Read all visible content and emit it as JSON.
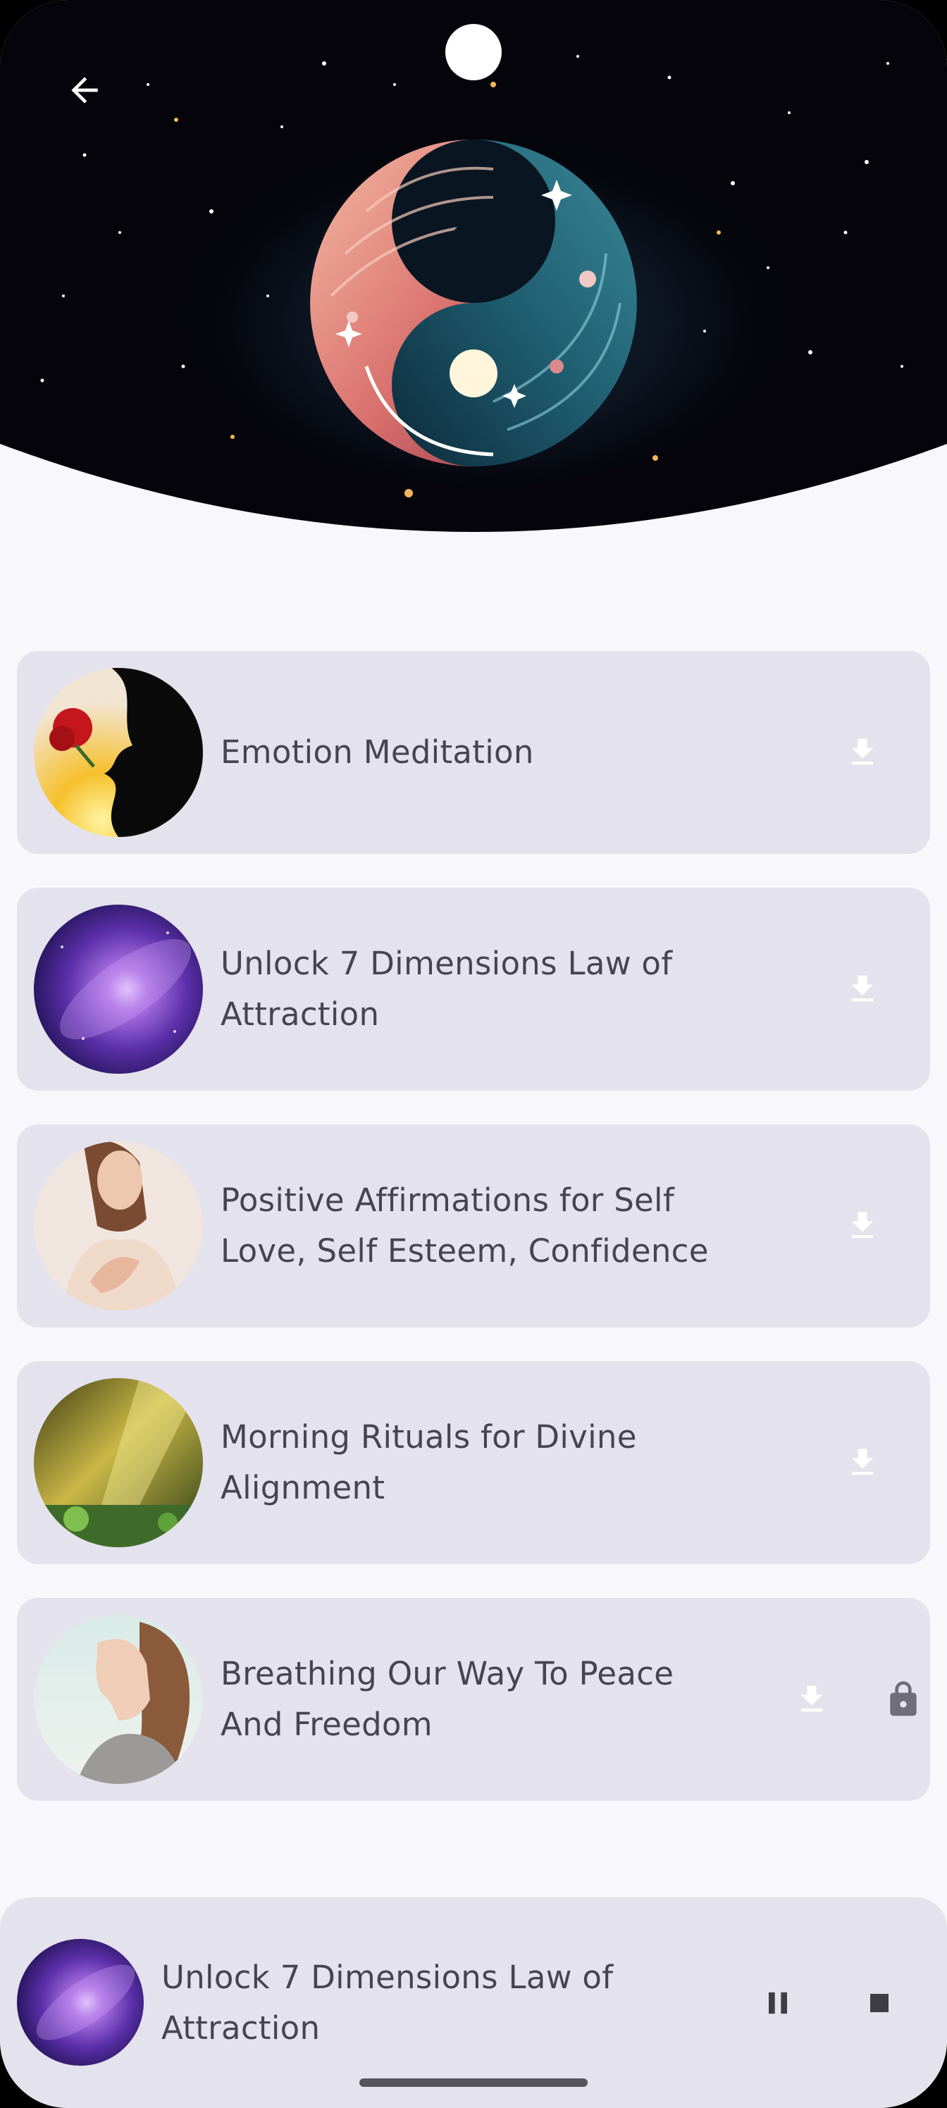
{
  "header": {
    "back_icon": "arrow-left-icon",
    "hero_image": "cosmic-yin-yang-on-starfield"
  },
  "tracks": [
    {
      "title": "Emotion Meditation",
      "thumbnail": "silhouette-kissing-rose",
      "download_icon": "download-icon",
      "locked": false
    },
    {
      "title": "Unlock 7 Dimensions Law of Attraction",
      "thumbnail": "purple-galaxy",
      "download_icon": "download-icon",
      "locked": false
    },
    {
      "title": "Positive Affirmations for Self Love, Self Esteem, Confidence",
      "thumbnail": "woman-hands-on-chest",
      "download_icon": "download-icon",
      "locked": false
    },
    {
      "title": "Morning Rituals for Divine Alignment",
      "thumbnail": "sunlit-forest",
      "download_icon": "download-icon",
      "locked": false
    },
    {
      "title": "Breathing Our Way To Peace And Freedom",
      "thumbnail": "woman-breathing-profile",
      "download_icon": "download-icon",
      "locked": true,
      "lock_icon": "lock-icon"
    }
  ],
  "player": {
    "now_playing_title": "Unlock 7 Dimensions Law of Attraction",
    "thumbnail": "purple-galaxy",
    "pause_icon": "pause-icon",
    "stop_icon": "stop-icon"
  },
  "colors": {
    "background": "#f8f7fc",
    "card": "#e4e2ec",
    "text": "#46444f",
    "icon_light": "#ffffff",
    "lock": "#6f6d77"
  }
}
